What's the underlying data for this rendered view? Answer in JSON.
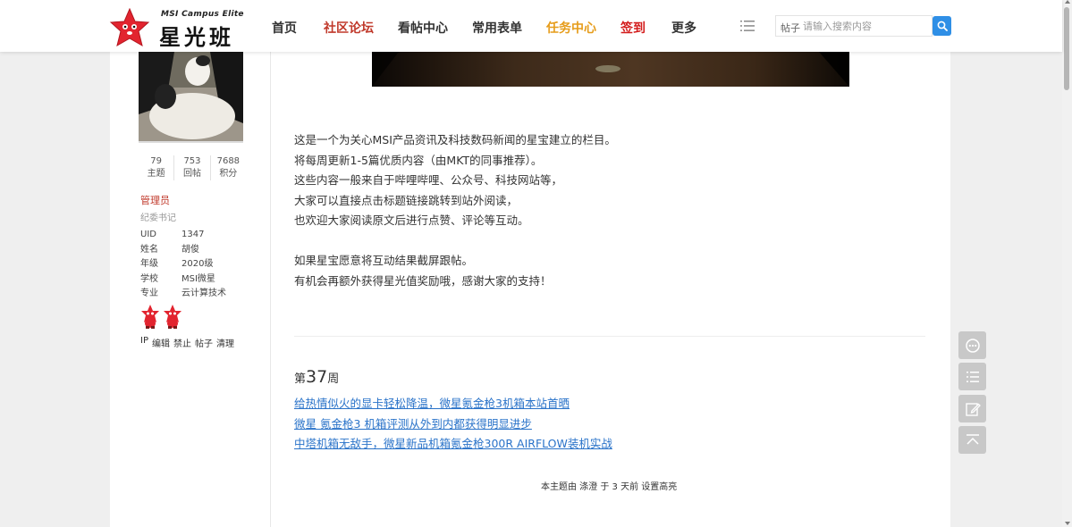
{
  "header": {
    "logo_sub": "MSI Campus Elite",
    "logo_main": "星光班",
    "nav": [
      {
        "label": "首页",
        "color": "#333333"
      },
      {
        "label": "社区论坛",
        "color": "#c0392b"
      },
      {
        "label": "看帖中心",
        "color": "#333333"
      },
      {
        "label": "常用表单",
        "color": "#333333"
      },
      {
        "label": "任务中心",
        "color": "#e69c1a"
      },
      {
        "label": "签到",
        "color": "#d31c1c"
      },
      {
        "label": "更多",
        "color": "#333333"
      }
    ],
    "search": {
      "type_label": "帖子",
      "placeholder": "请输入搜索内容"
    }
  },
  "sidebar": {
    "stats": [
      {
        "num": "79",
        "label": "主题"
      },
      {
        "num": "753",
        "label": "回帖"
      },
      {
        "num": "7688",
        "label": "积分"
      }
    ],
    "role": "管理员",
    "title": "纪委书记",
    "profile": [
      {
        "key": "UID",
        "value": "1347"
      },
      {
        "key": "姓名",
        "value": "胡俊"
      },
      {
        "key": "年级",
        "value": "2020级"
      },
      {
        "key": "学校",
        "value": "MSI微星"
      },
      {
        "key": "专业",
        "value": "云计算技术"
      }
    ],
    "admin_links": [
      "IP",
      "编辑",
      "禁止",
      "帖子",
      "清理"
    ]
  },
  "post": {
    "paragraphs": [
      "这是一个为关心MSI产品资讯及科技数码新闻的星宝建立的栏目。",
      "将每周更新1-5篇优质内容（由MKT的同事推荐）。",
      "这些内容一般来自于哔哩哔哩、公众号、科技网站等，",
      "大家可以直接点击标题链接跳转到站外阅读，",
      "也欢迎大家阅读原文后进行点赞、评论等互动。",
      "",
      "如果星宝愿意将互动结果截屏跟帖。",
      "有机会再额外获得星光值奖励哦，感谢大家的支持！"
    ],
    "week_prefix": "第",
    "week_number": "37",
    "week_suffix": "周",
    "links": [
      "给热情似火的显卡轻松降温，微星氪金枪3机箱本站首晒",
      "微星 氪金枪3 机箱评测从外到内都获得明显进步",
      "中塔机箱无敌手，微星新品机箱氪金枪300R AIRFLOW装机实战"
    ],
    "footer_note": "本主题由 涤澄 于 3 天前 设置高亮"
  }
}
